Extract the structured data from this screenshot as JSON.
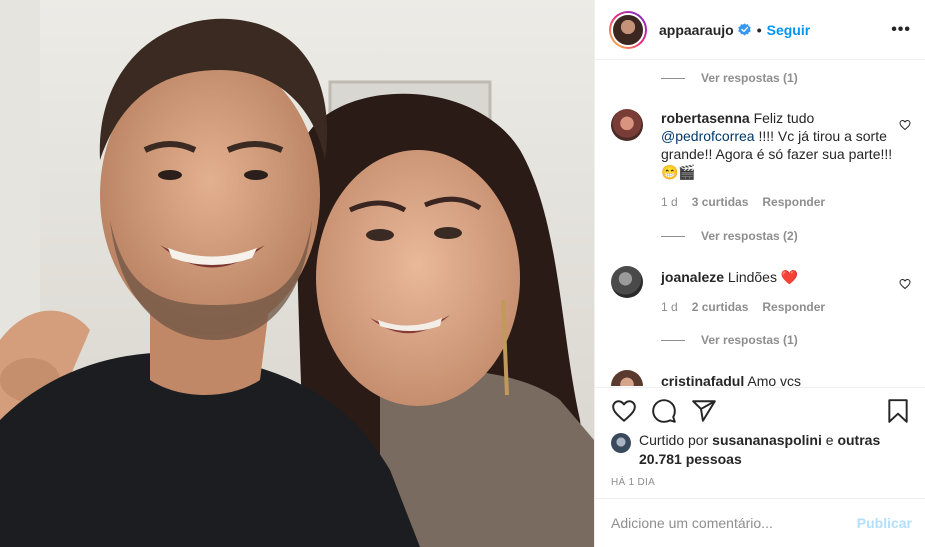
{
  "post": {
    "author": "appaaraujo",
    "follow_label": "Seguir",
    "more_label": "•••",
    "dot": "•"
  },
  "comments": [
    {
      "view_replies": "Ver respostas (1)"
    },
    {
      "username": "robertasenna",
      "text_before": "Feliz tudo",
      "mention": "@pedrofcorrea",
      "text_after": "!!!! Vc já tirou a sorte grande!! Agora é só fazer sua parte!!! 😁🎬",
      "time": "1 d",
      "likes": "3 curtidas",
      "reply": "Responder",
      "view_replies": "Ver respostas (2)"
    },
    {
      "username": "joanaleze",
      "text": "Lindões ❤️",
      "time": "1 d",
      "likes": "2 curtidas",
      "reply": "Responder",
      "view_replies": "Ver respostas (1)"
    },
    {
      "username": "cristinafadul",
      "text": "Amo vcs"
    }
  ],
  "likes": {
    "prefix": "Curtido por",
    "user": "susananaspolini",
    "middle": "e",
    "others": "outras 20.781 pessoas"
  },
  "timestamp": "HÁ 1 DIA",
  "add_comment": {
    "placeholder": "Adicione um comentário...",
    "post_label": "Publicar"
  },
  "colors": {
    "link": "#0095f6",
    "mention": "#00376b",
    "muted": "#8e8e8e",
    "publish_disabled": "#b2dffc",
    "heart": "#ed4956"
  },
  "icons": {
    "like": "heart-outline-icon",
    "comment": "comment-bubble-icon",
    "share": "paper-plane-icon",
    "save": "bookmark-icon",
    "verified": "verified-badge-icon",
    "comment_like": "small-heart-icon"
  }
}
